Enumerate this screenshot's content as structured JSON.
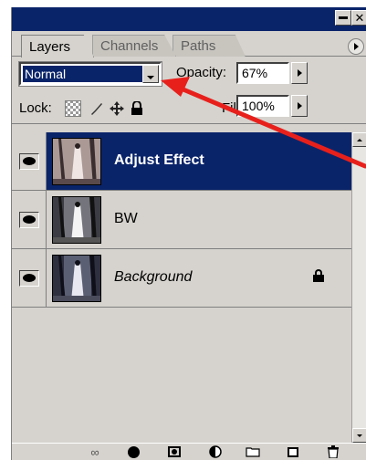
{
  "tabs": [
    {
      "label": "Layers",
      "active": true
    },
    {
      "label": "Channels",
      "active": false
    },
    {
      "label": "Paths",
      "active": false
    }
  ],
  "blend": {
    "mode": "Normal",
    "opacity_label": "Opacity:",
    "opacity_value": "67%"
  },
  "lock": {
    "label": "Lock:",
    "fill_label": "Fill:",
    "fill_value": "100%"
  },
  "layers": [
    {
      "name": "Adjust Effect",
      "selected": true,
      "visible": true
    },
    {
      "name": "BW",
      "selected": false,
      "visible": true
    },
    {
      "name": "Background",
      "selected": false,
      "visible": true,
      "locked": true
    }
  ],
  "icons": {
    "eye": "eye-icon",
    "lock_transparent": "lock-transparent-icon",
    "lock_paint": "brush-icon",
    "lock_position": "move-icon",
    "lock_all": "lock-icon",
    "bottom": [
      "link-icon",
      "fx-icon",
      "mask-icon",
      "adjustment-icon",
      "folder-icon",
      "new-layer-icon",
      "trash-icon"
    ]
  },
  "colors": {
    "selection": "#0a246a",
    "panel": "#d6d3ce",
    "annotation_arrow": "#e8201c"
  }
}
